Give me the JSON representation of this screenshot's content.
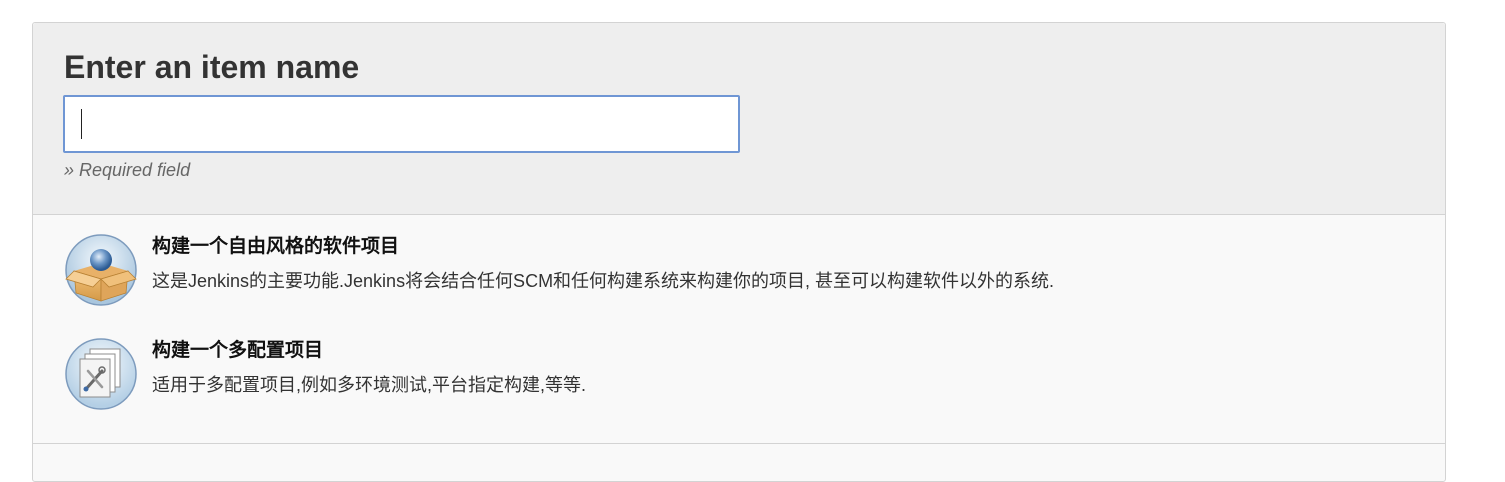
{
  "form": {
    "title": "Enter an item name",
    "name_value": "",
    "required_note": "» Required field"
  },
  "item_types": [
    {
      "icon": "freestyle-project-icon",
      "title": "构建一个自由风格的软件项目",
      "description": "这是Jenkins的主要功能.Jenkins将会结合任何SCM和任何构建系统来构建你的项目, 甚至可以构建软件以外的系统."
    },
    {
      "icon": "multi-configuration-project-icon",
      "title": "构建一个多配置项目",
      "description": "适用于多配置项目,例如多环境测试,平台指定构建,等等."
    }
  ],
  "colors": {
    "input_border": "#6f96d4",
    "header_bg": "#eeeeee",
    "list_bg": "#f9f9f9"
  }
}
